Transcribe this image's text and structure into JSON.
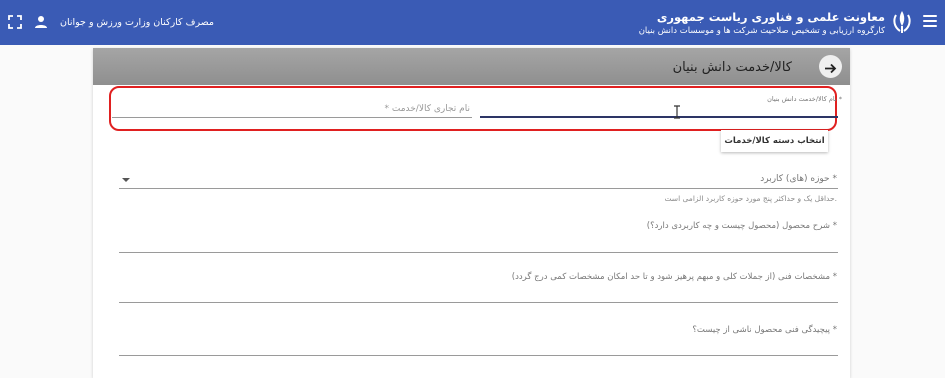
{
  "header": {
    "title": "معاونت علمی و فناوری ریاست جمهوری",
    "subtitle": "کارگروه ارزیابی و تشخیص صلاحیت شرکت ها و موسسات دانش بنیان",
    "ministry_label": "مصرف کارکنان وزارت ورزش و جوانان",
    "menu_icon": "menu-icon",
    "emblem": "emblem-logo",
    "user_icon": "account-icon",
    "fullscreen_icon": "fullscreen-icon"
  },
  "card": {
    "title": "کالا/خدمت دانش بنیان",
    "back_icon": "arrow-right-icon"
  },
  "form": {
    "product_name_label": "نام کالا/خدمت دانش بنیان *",
    "trade_name_placeholder": "نام تجاری کالا/خدمت *",
    "select_category_button": "انتخاب دسته کالا/خدمات",
    "application_domain_label": "حوزه (های) کاربرد *",
    "application_domain_hint": "حداقل یک و حداکثر پنج مورد حوزه کاربرد الزامی است.",
    "product_description_label": "شرح محصول (محصول چیست و چه کاربردی دارد؟) *",
    "technical_specs_label": "مشخصات فنی (از جملات کلی و مبهم پرهیز شود و تا حد امکان مشخصات کمی درج گردد) *",
    "technical_complexity_label": "پیچیدگی فنی محصول ناشی از چیست؟ *"
  },
  "colors": {
    "topbar": "#3a5bb5",
    "card_header": "#9b9b9b",
    "highlight_border": "#e02020",
    "active_underline": "#2d3566"
  }
}
